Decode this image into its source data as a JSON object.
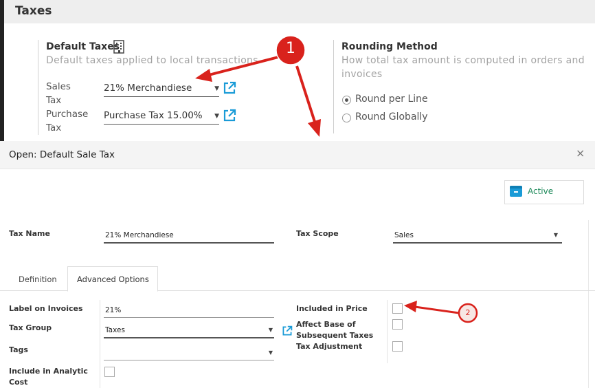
{
  "taxes_section": {
    "title": "Taxes",
    "default_taxes": {
      "title": "Default Taxes",
      "description": "Default taxes applied to local transactions",
      "sales_tax_label_line1": "Sales",
      "sales_tax_label_line2": "Tax",
      "sales_tax_value": "21% Merchandiese",
      "purchase_tax_label_line1": "Purchase",
      "purchase_tax_label_line2": "Tax",
      "purchase_tax_value": "Purchase Tax 15.00%",
      "building_icon": "building-icon",
      "external_link_icon": "external-link-icon"
    },
    "rounding_method": {
      "title": "Rounding Method",
      "description_line1": "How total tax amount is computed in orders and",
      "description_line2": "invoices",
      "options": [
        {
          "label": "Round per Line",
          "selected": true
        },
        {
          "label": "Round Globally",
          "selected": false
        }
      ]
    }
  },
  "modal": {
    "title": "Open: Default Sale Tax",
    "close_symbol": "×",
    "active_button_label": "Active",
    "active_icon": "archive-icon",
    "tax_name_label": "Tax Name",
    "tax_name_value": "21% Merchandiese",
    "tax_scope_label": "Tax Scope",
    "tax_scope_value": "Sales",
    "tabs": [
      {
        "label": "Definition",
        "active": false
      },
      {
        "label": "Advanced Options",
        "active": true
      }
    ],
    "advanced": {
      "label_on_invoices_label": "Label on Invoices",
      "label_on_invoices_value": "21%",
      "tax_group_label": "Tax Group",
      "tax_group_value": "Taxes",
      "tags_label": "Tags",
      "tags_value": "",
      "include_analytic_cost_line1": "Include in Analytic",
      "include_analytic_cost_line2": "Cost",
      "included_in_price_label": "Included in Price",
      "affect_base_line1": "Affect Base of",
      "affect_base_line2": "Subsequent Taxes",
      "tax_adjustment_label": "Tax Adjustment"
    }
  },
  "annotations": {
    "marker1": "1",
    "marker2": "2",
    "color": "#d9221c"
  },
  "colors": {
    "accent_blue": "#1a9bd7",
    "active_green": "#1f8a5b",
    "annotation_red": "#d9221c"
  }
}
